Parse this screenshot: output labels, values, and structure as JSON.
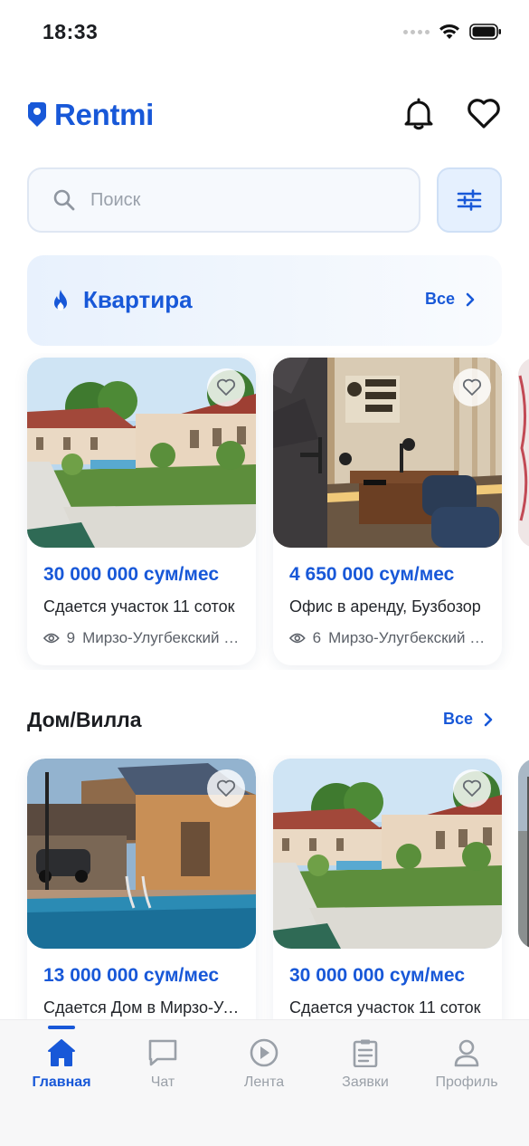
{
  "status_bar": {
    "time": "18:33"
  },
  "header": {
    "logo_text": "Rentmi"
  },
  "search": {
    "placeholder": "Поиск"
  },
  "sections": [
    {
      "title": "Квартира",
      "see_all": "Все",
      "cards": [
        {
          "price": "30 000 000 сум/мес",
          "title": "Сдается участок  11 соток",
          "views": "9",
          "location": "Мирзо-Улугбекский район"
        },
        {
          "price": "4 650 000 сум/мес",
          "title": "Офис в аренду, Бузбозор",
          "views": "6",
          "location": "Мирзо-Улугбекский район"
        }
      ]
    },
    {
      "title": "Дом/Вилла",
      "see_all": "Все",
      "cards": [
        {
          "price": "13 000 000 сум/мес",
          "title": "Сдается Дом в Мирзо-Улугбеке"
        },
        {
          "price": "30 000 000 сум/мес",
          "title": "Сдается участок  11 соток"
        }
      ]
    }
  ],
  "tabs": [
    {
      "label": "Главная",
      "icon": "home-icon",
      "active": true
    },
    {
      "label": "Чат",
      "icon": "chat-icon",
      "active": false
    },
    {
      "label": "Лента",
      "icon": "play-icon",
      "active": false
    },
    {
      "label": "Заявки",
      "icon": "clipboard-icon",
      "active": false
    },
    {
      "label": "Профиль",
      "icon": "profile-icon",
      "active": false
    }
  ],
  "colors": {
    "accent": "#1858d8",
    "inactive": "#9aa0a8",
    "banner_bg": "#e8f1fd"
  }
}
